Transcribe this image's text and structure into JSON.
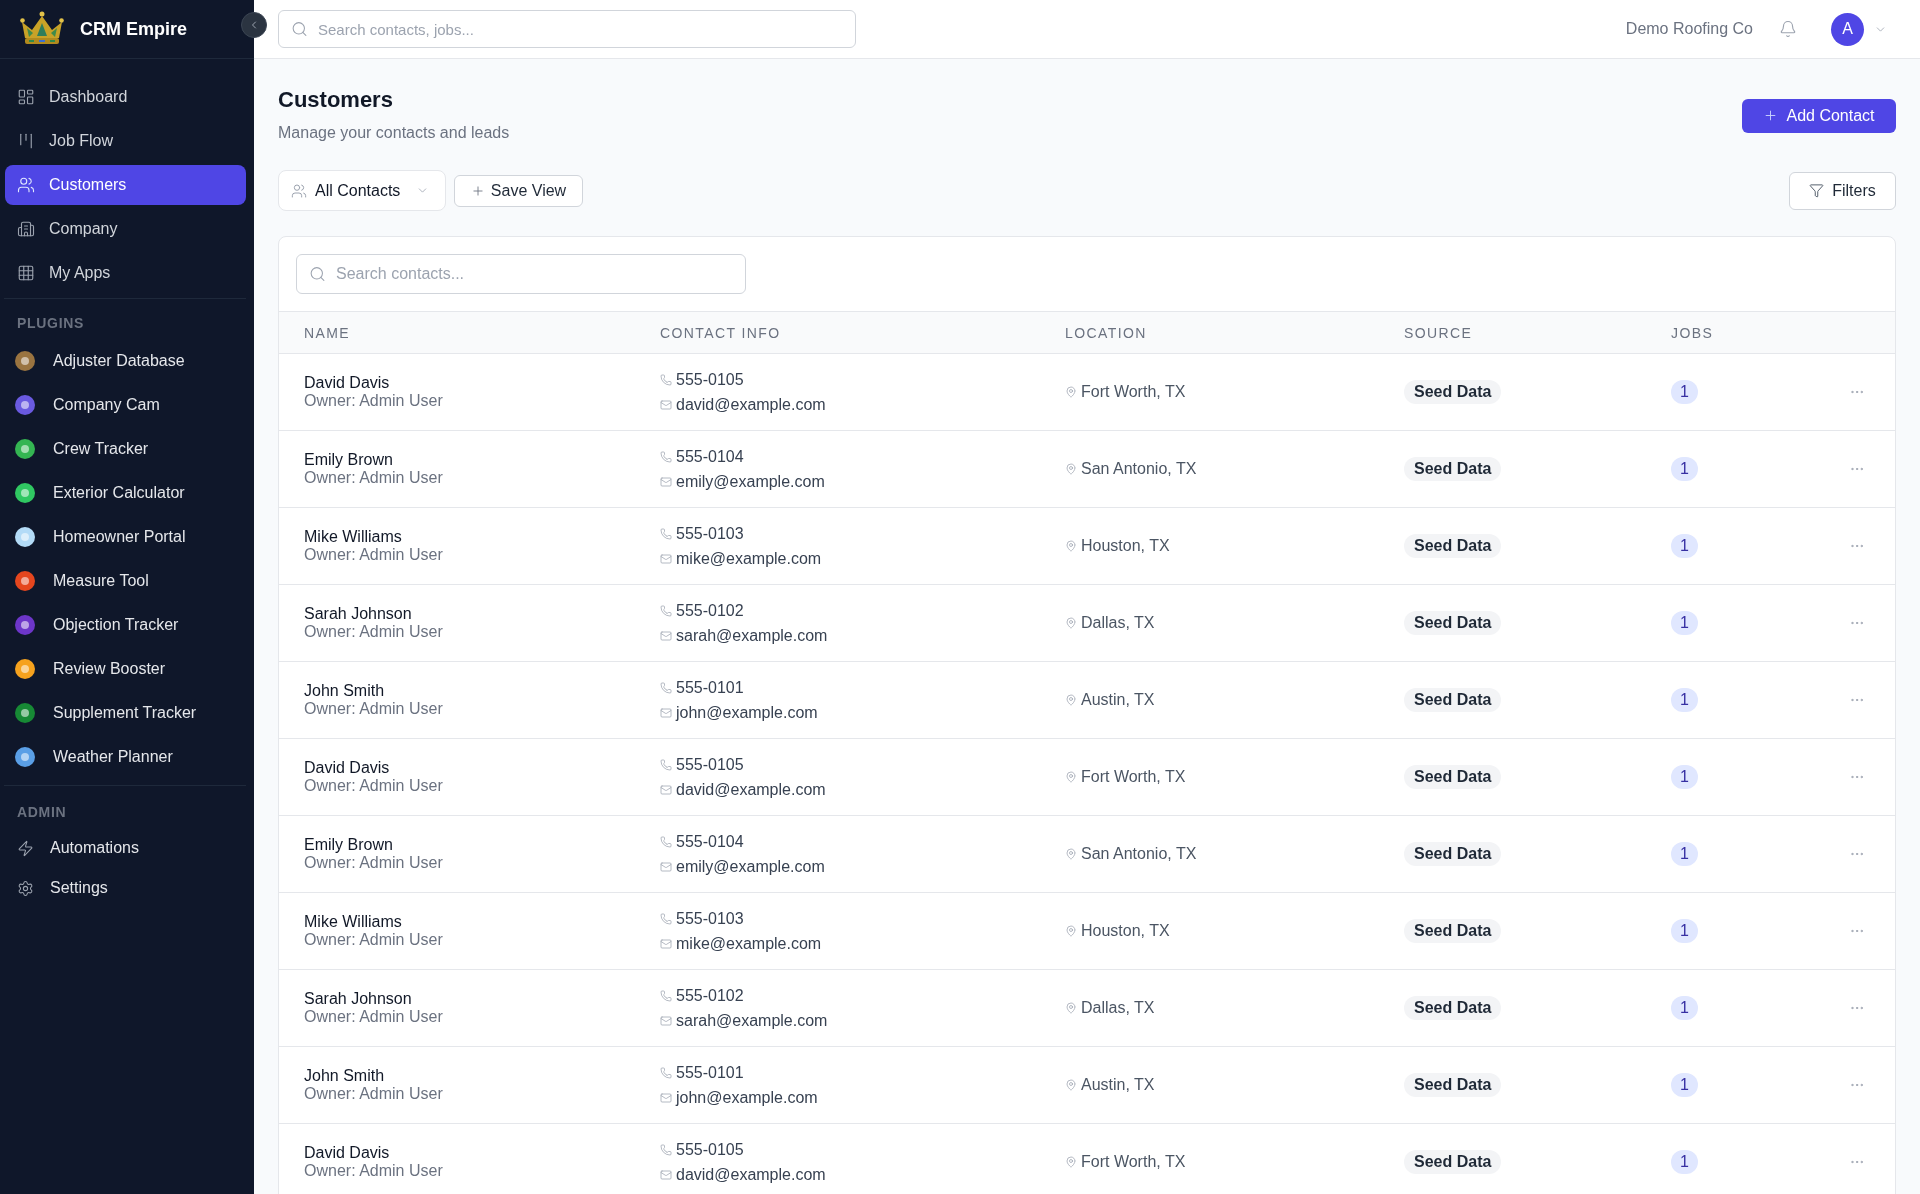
{
  "sidebar": {
    "brand": "CRM Empire",
    "nav": [
      {
        "label": "Dashboard",
        "selected": false
      },
      {
        "label": "Job Flow",
        "selected": false
      },
      {
        "label": "Customers",
        "selected": true
      },
      {
        "label": "Company",
        "selected": false
      },
      {
        "label": "My Apps",
        "selected": false
      }
    ],
    "plugins": {
      "title": "PLUGINS",
      "items": [
        {
          "label": "Adjuster Database",
          "color": "#9a7440",
          "selected": false
        },
        {
          "label": "Company Cam",
          "color": "#6a5ae0",
          "selected": false
        },
        {
          "label": "Crew Tracker",
          "color": "#34b552",
          "selected": false
        },
        {
          "label": "Exterior Calculator",
          "color": "#30c862",
          "selected": false
        },
        {
          "label": "Homeowner Portal",
          "color": "#b3dbf7",
          "selected": false
        },
        {
          "label": "Measure Tool",
          "color": "#e5461e",
          "selected": false
        },
        {
          "label": "Objection Tracker",
          "color": "#6d36c9",
          "selected": false
        },
        {
          "label": "Review Booster",
          "color": "#f6a21e",
          "selected": false
        },
        {
          "label": "Supplement Tracker",
          "color": "#178a35",
          "selected": false
        },
        {
          "label": "Weather Planner",
          "color": "#5a9fe6",
          "selected": false
        }
      ]
    },
    "admin": {
      "title": "ADMIN",
      "items": [
        {
          "label": "Automations",
          "selected": false
        },
        {
          "label": "Settings",
          "selected": false
        }
      ]
    }
  },
  "top_bar": {
    "search": {
      "placeholder": "Search contacts, jobs..."
    },
    "company": "Demo Roofing Co",
    "avatar": "A"
  },
  "page": {
    "title": "Customers",
    "subtitle": "Manage your contacts and leads",
    "add_button": "Add Contact",
    "view_select": "All Contacts",
    "save_view_button": "Save View",
    "filters_button": "Filters"
  },
  "table": {
    "search": {
      "placeholder": "Search contacts..."
    },
    "columns": [
      "NAME",
      "CONTACT INFO",
      "LOCATION",
      "SOURCE",
      "JOBS"
    ],
    "rows": [
      {
        "name": "David Davis",
        "owner": "Owner: Admin User",
        "phone": "555-0105",
        "email": "david@example.com",
        "location": "Fort Worth, TX",
        "source": "Seed Data",
        "jobs": "1"
      },
      {
        "name": "Emily Brown",
        "owner": "Owner: Admin User",
        "phone": "555-0104",
        "email": "emily@example.com",
        "location": "San Antonio, TX",
        "source": "Seed Data",
        "jobs": "1"
      },
      {
        "name": "Mike Williams",
        "owner": "Owner: Admin User",
        "phone": "555-0103",
        "email": "mike@example.com",
        "location": "Houston, TX",
        "source": "Seed Data",
        "jobs": "1"
      },
      {
        "name": "Sarah Johnson",
        "owner": "Owner: Admin User",
        "phone": "555-0102",
        "email": "sarah@example.com",
        "location": "Dallas, TX",
        "source": "Seed Data",
        "jobs": "1"
      },
      {
        "name": "John Smith",
        "owner": "Owner: Admin User",
        "phone": "555-0101",
        "email": "john@example.com",
        "location": "Austin, TX",
        "source": "Seed Data",
        "jobs": "1"
      },
      {
        "name": "David Davis",
        "owner": "Owner: Admin User",
        "phone": "555-0105",
        "email": "david@example.com",
        "location": "Fort Worth, TX",
        "source": "Seed Data",
        "jobs": "1"
      },
      {
        "name": "Emily Brown",
        "owner": "Owner: Admin User",
        "phone": "555-0104",
        "email": "emily@example.com",
        "location": "San Antonio, TX",
        "source": "Seed Data",
        "jobs": "1"
      },
      {
        "name": "Mike Williams",
        "owner": "Owner: Admin User",
        "phone": "555-0103",
        "email": "mike@example.com",
        "location": "Houston, TX",
        "source": "Seed Data",
        "jobs": "1"
      },
      {
        "name": "Sarah Johnson",
        "owner": "Owner: Admin User",
        "phone": "555-0102",
        "email": "sarah@example.com",
        "location": "Dallas, TX",
        "source": "Seed Data",
        "jobs": "1"
      },
      {
        "name": "John Smith",
        "owner": "Owner: Admin User",
        "phone": "555-0101",
        "email": "john@example.com",
        "location": "Austin, TX",
        "source": "Seed Data",
        "jobs": "1"
      },
      {
        "name": "David Davis",
        "owner": "Owner: Admin User",
        "phone": "555-0105",
        "email": "david@example.com",
        "location": "Fort Worth, TX",
        "source": "Seed Data",
        "jobs": "1"
      }
    ]
  }
}
